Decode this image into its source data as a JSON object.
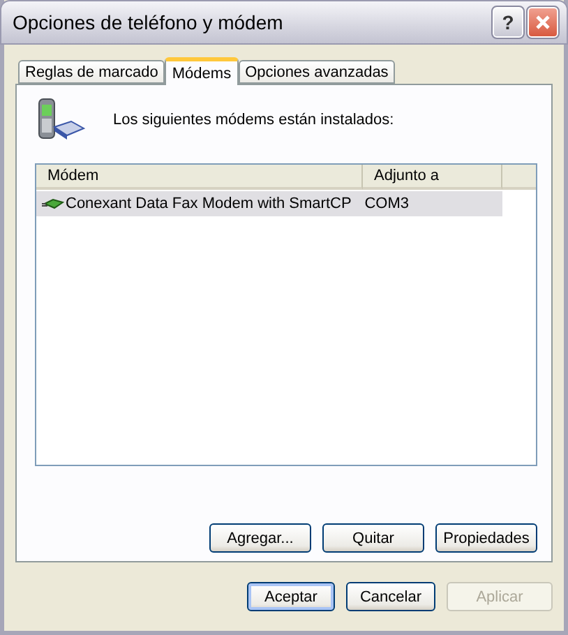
{
  "window": {
    "title": "Opciones de teléfono y módem",
    "help_button": "?"
  },
  "tabs": [
    {
      "label": "Reglas de marcado",
      "selected": false
    },
    {
      "label": "Módems",
      "selected": true
    },
    {
      "label": "Opciones avanzadas",
      "selected": false
    }
  ],
  "intro": "Los siguientes módems están instalados:",
  "table": {
    "columns": [
      "Módem",
      "Adjunto a"
    ],
    "rows": [
      {
        "modem": "Conexant Data Fax Modem with SmartCP",
        "port": "COM3",
        "selected": true
      }
    ]
  },
  "panel_buttons": [
    {
      "label": "Agregar...",
      "disabled": false
    },
    {
      "label": "Quitar",
      "disabled": false
    },
    {
      "label": "Propiedades",
      "disabled": false
    }
  ],
  "dialog_buttons": [
    {
      "label": "Aceptar",
      "disabled": false,
      "default": true
    },
    {
      "label": "Cancelar",
      "disabled": false,
      "default": false
    },
    {
      "label": "Aplicar",
      "disabled": true,
      "default": false
    }
  ]
}
